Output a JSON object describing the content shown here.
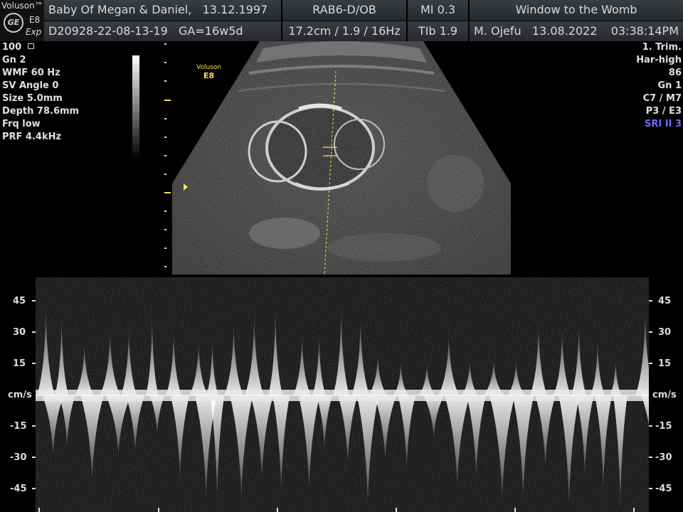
{
  "header": {
    "brand": "Voluson™",
    "logo_text": "GE",
    "model": "E8",
    "exp": "Exp",
    "patient": "Baby Of Megan & Daniel,",
    "dob": "13.12.1997",
    "probe_preset": "RAB6-D/OB",
    "mi": "MI  0.3",
    "clinic": "Window to the Womb",
    "exam_id": "D20928-22-08-13-19",
    "ga": "GA=16w5d",
    "depth_info": "17.2cm / 1.9 / 16Hz",
    "tib": "TIb  1.9",
    "operator": "M. Ojefu",
    "date": "13.08.2022",
    "time": "03:38:14PM"
  },
  "left_params": [
    "100",
    "Gn  2",
    "WMF 60 Hz",
    "SV Angle  0",
    "Size  5.0mm",
    "Depth 78.6mm",
    "Frq low",
    "PRF  4.4kHz"
  ],
  "right_params": [
    "1. Trim.",
    "Har-high",
    "86",
    "Gn   1",
    "C7 / M7",
    "P3 / E3",
    "SRI II 3"
  ],
  "image_label": {
    "line1": "Voluson",
    "line2": "E8"
  },
  "doppler_axis": {
    "unit": "cm/s",
    "ticks": [
      "45",
      "30",
      "15",
      "-15",
      "-30",
      "-45"
    ]
  },
  "colors": {
    "header_bg": "#2f3238",
    "label_yellow": "#ffe34d",
    "sri_blue": "#6b6bff"
  }
}
